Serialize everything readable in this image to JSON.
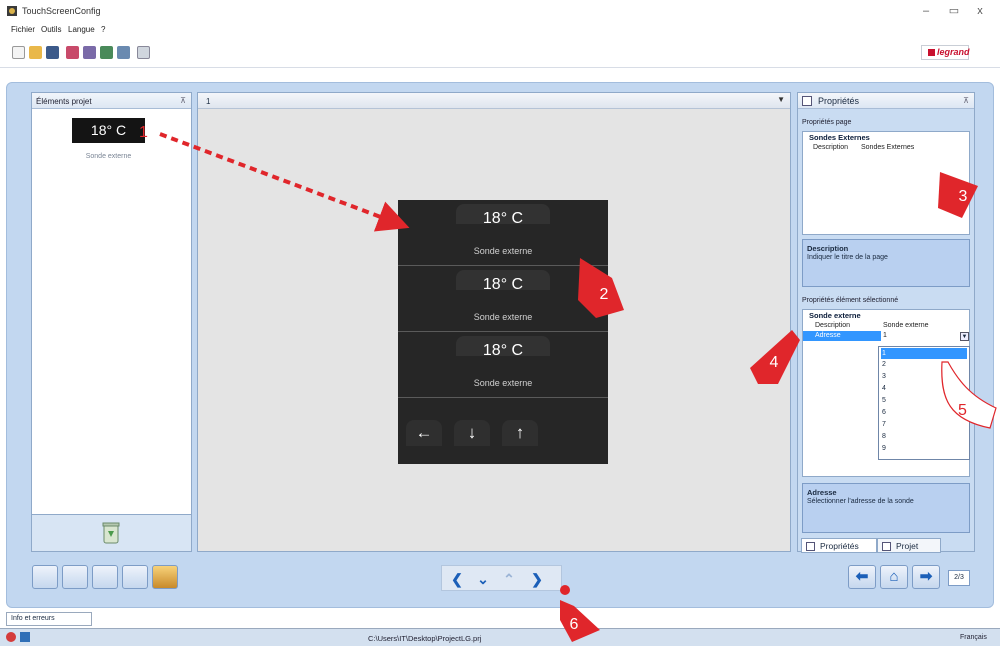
{
  "window": {
    "title": "TouchScreenConfig",
    "minimize": "–",
    "maximize": "▭",
    "close": "x"
  },
  "menu": [
    "Fichier",
    "Outils",
    "Langue",
    "?"
  ],
  "toolbar": {
    "brand": "legrand"
  },
  "left_panel": {
    "title": "Éléments projet",
    "thumbnail_value": "18° C",
    "thumbnail_caption": "Sonde externe"
  },
  "center": {
    "page_number": "1",
    "tiles": [
      {
        "temp": "18° C",
        "label": "Sonde externe"
      },
      {
        "temp": "18° C",
        "label": "Sonde externe"
      },
      {
        "temp": "18° C",
        "label": "Sonde externe"
      }
    ],
    "nav": [
      "←",
      "↓",
      "↑"
    ]
  },
  "right_panel": {
    "title": "Propriétés",
    "page_props_label": "Propriétés page",
    "page_category": "Sondes Externes",
    "page_row_key": "Description",
    "page_row_value": "Sondes Externes",
    "desc_title": "Description",
    "desc_text": "Indiquer le titre de la page",
    "elem_props_label": "Propriétés élément sélectionné",
    "elem_category": "Sonde externe",
    "elem_row1_key": "Description",
    "elem_row1_value": "Sonde externe",
    "elem_row2_key": "Adresse",
    "elem_row2_value": "1",
    "dropdown_options": [
      "1",
      "2",
      "3",
      "4",
      "5",
      "6",
      "7",
      "8",
      "9"
    ],
    "dropdown_selected": "1",
    "addr_title": "Adresse",
    "addr_text": "Sélectionner l'adresse de la sonde",
    "tab_props": "Propriétés",
    "tab_project": "Projet"
  },
  "bottom": {
    "page_counter": "2/3",
    "info_tab": "Info et erreurs"
  },
  "status": {
    "path": "C:\\Users\\IT\\Desktop\\ProjectLG.prj",
    "language": "Français"
  },
  "annotations": [
    "1",
    "2",
    "3",
    "4",
    "5",
    "6"
  ],
  "colors": {
    "accent": "#1b5fb8",
    "callout": "#e0262b",
    "device_bg": "#262626",
    "selection": "#3296ff"
  }
}
